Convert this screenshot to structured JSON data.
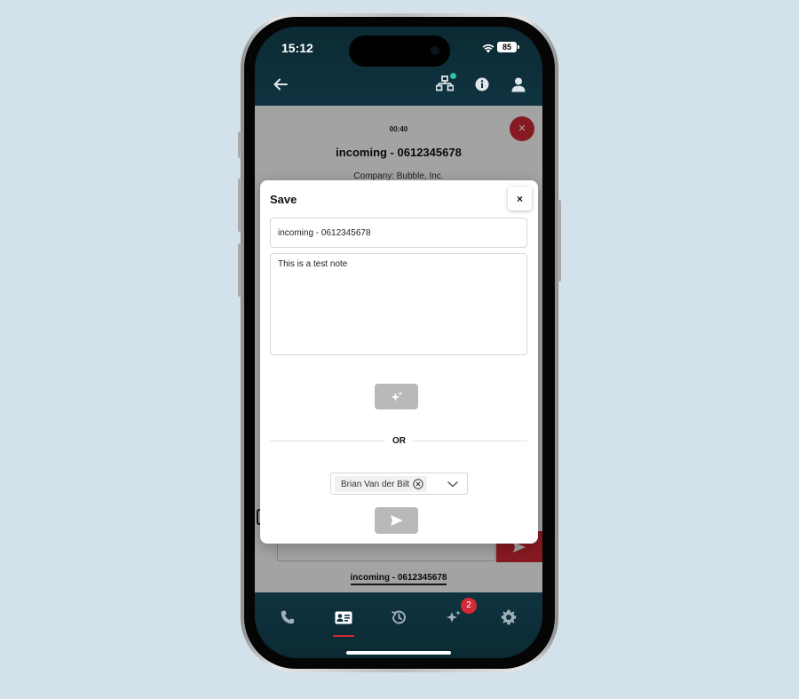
{
  "status_bar": {
    "time": "15:12",
    "battery": "85"
  },
  "header": {
    "icons": [
      "back-arrow-icon",
      "network-icon",
      "info-icon",
      "user-icon"
    ]
  },
  "call": {
    "timer": "00:40",
    "title": "incoming - 0612345678",
    "company": "Company: Bubble, Inc.",
    "tab_label": "incoming - 0612345678"
  },
  "modal": {
    "title": "Save",
    "close_label": "×",
    "title_value": "incoming - 0612345678",
    "note_value": "This is a test note",
    "divider_text": "OR",
    "selected_contact": "Brian Van der Bilt"
  },
  "bottom_nav": {
    "items": [
      "phone-icon",
      "contact-card-icon",
      "history-icon",
      "sparkle-icon",
      "gear-icon"
    ],
    "active": "contact-card-icon",
    "badge_count": "2"
  },
  "colors": {
    "accent": "#d32a35",
    "header_bg": "#0f3340",
    "disabled_button": "#b9b9b9",
    "page_bg": "#d3e2ea"
  }
}
